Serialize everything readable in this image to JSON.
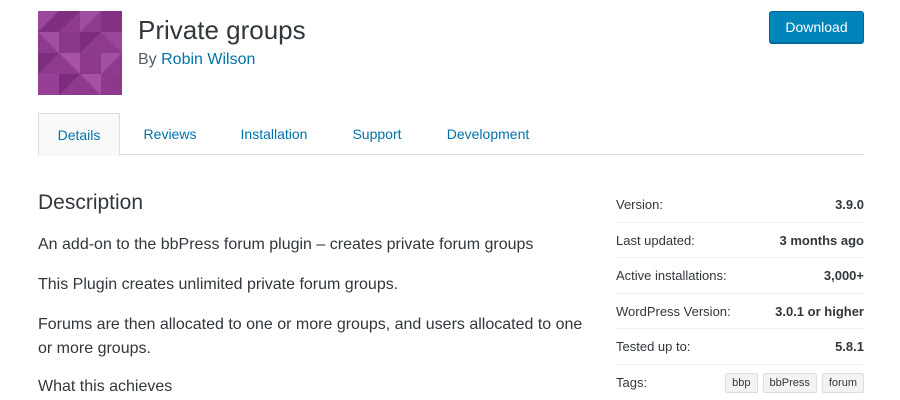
{
  "header": {
    "title": "Private groups",
    "author_prefix": "By",
    "author_name": "Robin Wilson",
    "download_label": "Download",
    "icon_name": "plugin-banner-icon",
    "icon_color": "#8e3a8e"
  },
  "tabs": [
    {
      "label": "Details",
      "active": true
    },
    {
      "label": "Reviews",
      "active": false
    },
    {
      "label": "Installation",
      "active": false
    },
    {
      "label": "Support",
      "active": false
    },
    {
      "label": "Development",
      "active": false
    }
  ],
  "description": {
    "heading": "Description",
    "paragraphs": [
      "An add-on to the bbPress forum plugin – creates private forum groups",
      "This Plugin creates unlimited private forum groups.",
      "Forums are then allocated to one or more groups, and users allocated to one or more groups.",
      "What this achieves"
    ]
  },
  "meta": {
    "rows": [
      {
        "label": "Version:",
        "value": "3.9.0"
      },
      {
        "label": "Last updated:",
        "value": "3 months ago"
      },
      {
        "label": "Active installations:",
        "value": "3,000+"
      },
      {
        "label": "WordPress Version:",
        "value": "3.0.1 or higher"
      },
      {
        "label": "Tested up to:",
        "value": "5.8.1"
      }
    ],
    "tags_label": "Tags:",
    "tags": [
      "bbp",
      "bbPress",
      "forum"
    ]
  },
  "colors": {
    "accent": "#0085ba",
    "link": "#0073aa",
    "text": "#32373c"
  }
}
